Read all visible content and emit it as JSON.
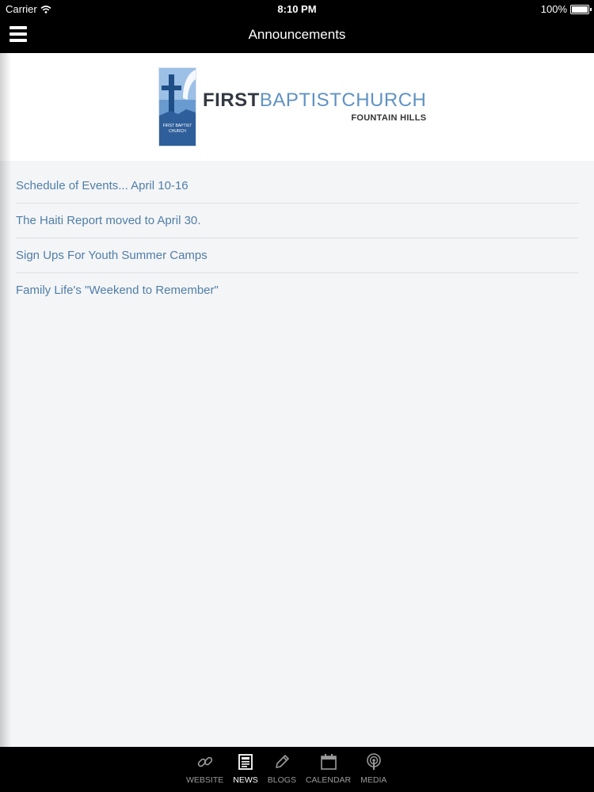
{
  "status_bar": {
    "carrier": "Carrier",
    "time": "8:10 PM",
    "battery": "100%"
  },
  "nav": {
    "title": "Announcements"
  },
  "logo": {
    "line1_a": "FIRST",
    "line1_b": "BAPTIST",
    "line1_c": "CHURCH",
    "line2": "FOUNTAIN HILLS",
    "mark_text": "FIRST BAPTIST CHURCH"
  },
  "announcements": [
    "Schedule of Events... April 10-16",
    "The Haiti Report moved to April 30.",
    "Sign Ups For Youth Summer Camps",
    "Family Life's \"Weekend to Remember\""
  ],
  "tabs": [
    {
      "label": "WEBSITE",
      "icon": "link-icon"
    },
    {
      "label": "NEWS",
      "icon": "news-icon",
      "active": true
    },
    {
      "label": "BLOGS",
      "icon": "pencil-icon"
    },
    {
      "label": "CALENDAR",
      "icon": "calendar-icon"
    },
    {
      "label": "MEDIA",
      "icon": "podcast-icon"
    }
  ],
  "colors": {
    "link": "#4f7ea8",
    "brand_blue": "#5f92c2",
    "bar": "#000000"
  }
}
